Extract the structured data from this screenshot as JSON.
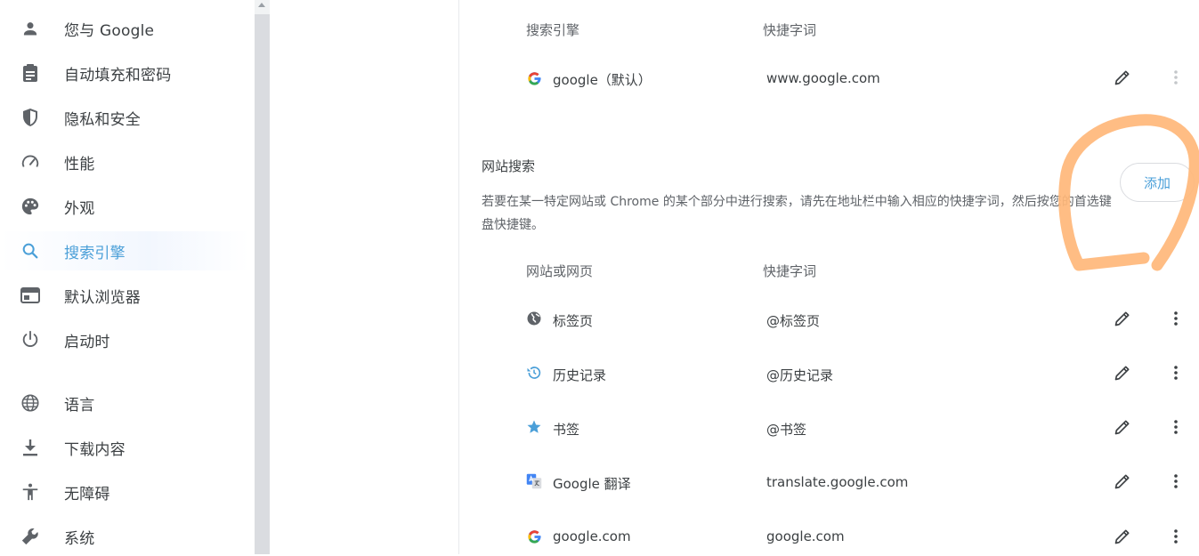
{
  "sidebar": {
    "items": [
      {
        "label": "您与 Google",
        "icon": "person-icon"
      },
      {
        "label": "自动填充和密码",
        "icon": "clipboard-icon"
      },
      {
        "label": "隐私和安全",
        "icon": "shield-icon"
      },
      {
        "label": "性能",
        "icon": "speedometer-icon"
      },
      {
        "label": "外观",
        "icon": "palette-icon"
      },
      {
        "label": "搜索引擎",
        "icon": "search-icon",
        "active": true
      },
      {
        "label": "默认浏览器",
        "icon": "browser-window-icon"
      },
      {
        "label": "启动时",
        "icon": "power-icon"
      },
      {
        "label": "语言",
        "icon": "globe-icon"
      },
      {
        "label": "下载内容",
        "icon": "download-icon"
      },
      {
        "label": "无障碍",
        "icon": "accessibility-icon"
      },
      {
        "label": "系统",
        "icon": "wrench-icon"
      }
    ]
  },
  "search_engines": {
    "header_name": "搜索引擎",
    "header_shortcut": "快捷字词",
    "rows": [
      {
        "name": "google（默认）",
        "shortcut": "www.google.com",
        "icon": "google-g-icon"
      }
    ]
  },
  "site_search": {
    "title": "网站搜索",
    "description": "若要在某一特定网站或 Chrome 的某个部分中进行搜索，请先在地址栏中输入相应的快捷字词，然后按您的首选键盘快捷键。",
    "add_label": "添加",
    "header_name": "网站或网页",
    "header_shortcut": "快捷字词",
    "rows": [
      {
        "name": "标签页",
        "shortcut": "@标签页",
        "icon": "globe-icon"
      },
      {
        "name": "历史记录",
        "shortcut": "@历史记录",
        "icon": "history-icon"
      },
      {
        "name": "书签",
        "shortcut": "@书签",
        "icon": "star-icon"
      },
      {
        "name": "Google 翻译",
        "shortcut": "translate.google.com",
        "icon": "google-translate-icon"
      },
      {
        "name": "google.com",
        "shortcut": "google.com",
        "icon": "google-g-icon"
      }
    ]
  },
  "colors": {
    "accent": "#4a9fd8",
    "annotation": "#ffb77a",
    "text": "#3c4043",
    "secondary_text": "#5f6368"
  }
}
